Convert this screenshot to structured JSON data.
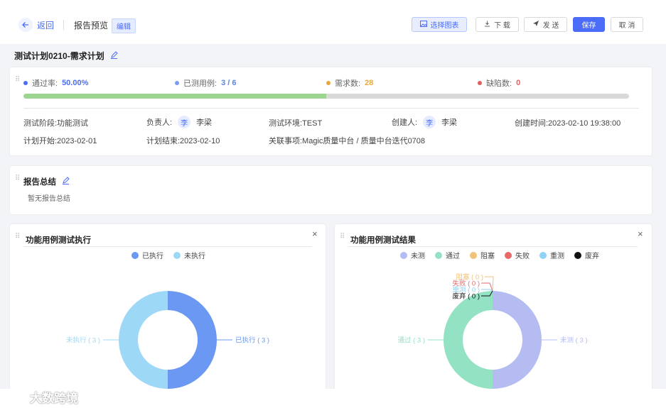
{
  "header": {
    "back_label": "返回",
    "page_title": "报告预览",
    "edit_tag": "编辑",
    "buttons": {
      "select_chart": "选择图表",
      "download": "下 载",
      "send": "发 送",
      "save": "保存",
      "cancel": "取 消"
    }
  },
  "plan_name": "测试计划0210-需求计划",
  "stats": {
    "pass_rate_label": "通过率:",
    "pass_rate_value": "50.00%",
    "tested_label": "已测用例:",
    "tested_value": "3 / 6",
    "req_label": "需求数:",
    "req_value": "28",
    "defect_label": "缺陷数:",
    "defect_value": "0",
    "progress_fraction": 0.5,
    "colors": {
      "pass": "#4a6cf7",
      "tested": "#7b9cf0",
      "req": "#e8a83a",
      "defect": "#e06060",
      "bar": "#9cd58f"
    }
  },
  "info": {
    "stage": "测试阶段:功能测试",
    "owner_label": "负责人:",
    "owner_avatar": "李",
    "owner_name": "李梁",
    "env": "测试环境:TEST",
    "creator_label": "创建人:",
    "creator_avatar": "李",
    "creator_name": "李梁",
    "created_time": "创建时间:2023-02-10 19:38:00",
    "plan_start": "计划开始:2023-02-01",
    "plan_end": "计划结束:2023-02-10",
    "related": "关联事项:Magic质量中台 / 质量中台迭代0708"
  },
  "summary": {
    "title": "报告总结",
    "empty_text": "暂无报告总结"
  },
  "chart_data": [
    {
      "type": "pie",
      "title": "功能用例测试执行",
      "categories": [
        "已执行",
        "未执行"
      ],
      "values": [
        3,
        3
      ],
      "colors": [
        "#6b98f3",
        "#9dd9f7"
      ],
      "labels": [
        "已执行 ( 3 )",
        "未执行 ( 3 )"
      ],
      "legend": "top"
    },
    {
      "type": "pie",
      "title": "功能用例测试结果",
      "categories": [
        "未测",
        "通过",
        "阻塞",
        "失败",
        "重测",
        "废弃"
      ],
      "values": [
        3,
        3,
        0,
        0,
        0,
        0
      ],
      "colors": [
        "#b4bcf2",
        "#93e2c3",
        "#f1c37a",
        "#e56a6a",
        "#8fd2f5",
        "#111111"
      ],
      "labels": [
        "未测 ( 3 )",
        "通过 ( 3 )",
        "阻塞 ( 0 )",
        "失败 ( 0 )",
        "重测 ( 0 )",
        "废弃 ( 0 )"
      ],
      "legend": "top"
    }
  ],
  "watermark": "大数跨境"
}
